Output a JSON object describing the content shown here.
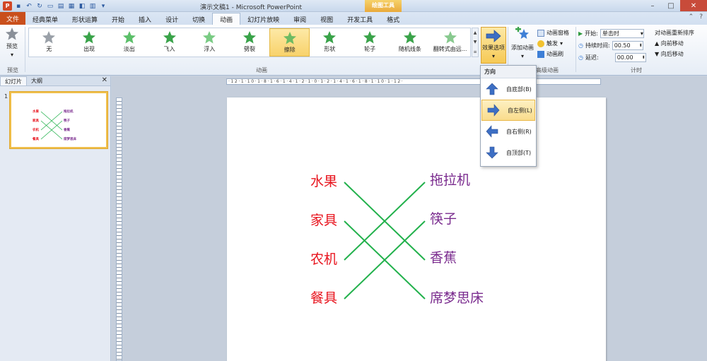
{
  "window": {
    "title": "演示文稿1 - Microsoft PowerPoint",
    "tool_context": "绘图工具"
  },
  "tabs": {
    "file": "文件",
    "items": [
      "经典菜单",
      "形状运算",
      "开始",
      "插入",
      "设计",
      "切换",
      "动画",
      "幻灯片放映",
      "审阅",
      "视图",
      "开发工具",
      "格式"
    ]
  },
  "ribbon": {
    "preview": {
      "label": "预览",
      "group": "预览"
    },
    "animation_gallery": {
      "items": [
        "无",
        "出现",
        "淡出",
        "飞入",
        "浮入",
        "劈裂",
        "擦除",
        "形状",
        "轮子",
        "随机线条",
        "翻转式由远..."
      ],
      "selected": "擦除",
      "group": "动画"
    },
    "effect_options": "效果选项",
    "add_animation": "添加动画",
    "advanced": {
      "items": [
        "动画窗格",
        "触发",
        "动画刷"
      ],
      "group": "高级动画"
    },
    "timing": {
      "start_label": "开始:",
      "start_value": "单击时",
      "duration_label": "持续时间:",
      "duration_value": "00.50",
      "delay_label": "延迟:",
      "delay_value": "00.00",
      "group": "计时"
    },
    "reorder": {
      "title": "对动画重新排序",
      "forward": "向前移动",
      "backward": "向后移动"
    }
  },
  "left_pane": {
    "tab_slides": "幻灯片",
    "tab_outline": "大纲",
    "slide_number": "1"
  },
  "ruler": {
    "horizontal": "·12·1·10·1·8·1·6·1·4·1·2·1·0·1·2·1·4·1·6·1·8·1·10·1·12·"
  },
  "slide": {
    "left_words": [
      "水果",
      "家具",
      "农机",
      "餐具"
    ],
    "right_words": [
      "拖拉机",
      "筷子",
      "香蕉",
      "席梦思床"
    ],
    "connections": [
      [
        0,
        2
      ],
      [
        1,
        3
      ],
      [
        2,
        0
      ],
      [
        3,
        1
      ]
    ],
    "line_color": "#22b14c",
    "left_color": "#e8141e",
    "right_color": "#7a2b8e"
  },
  "dropdown": {
    "header": "方向",
    "items": [
      {
        "label": "自底部(B)",
        "icon": "arrow-up-icon"
      },
      {
        "label": "自左侧(L)",
        "icon": "arrow-right-icon"
      },
      {
        "label": "自右侧(R)",
        "icon": "arrow-left-icon"
      },
      {
        "label": "自顶部(T)",
        "icon": "arrow-down-icon"
      }
    ],
    "selected_index": 1
  }
}
